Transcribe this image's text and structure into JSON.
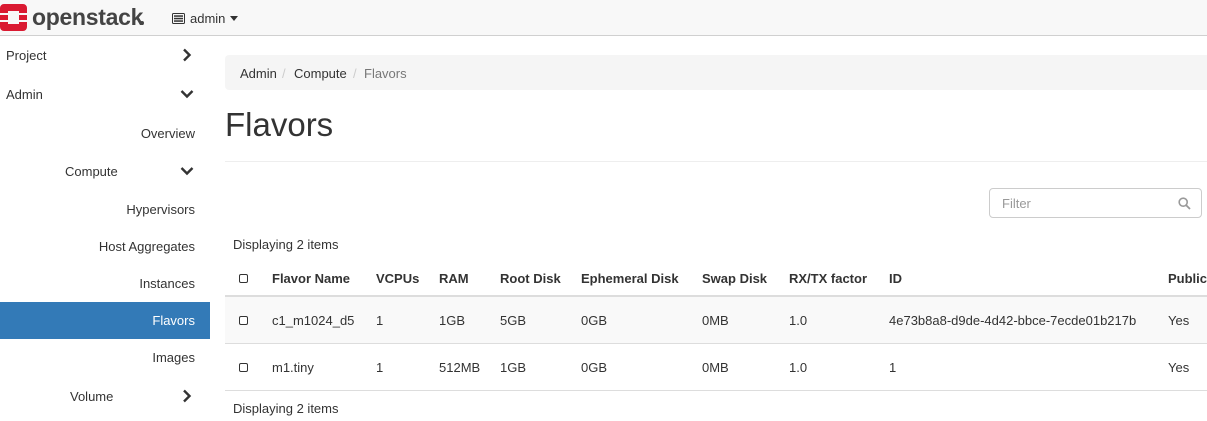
{
  "navbar": {
    "brand": "openstack",
    "project_menu": {
      "label": "admin"
    }
  },
  "sidebar": {
    "items": [
      {
        "label": "Project"
      },
      {
        "label": "Admin"
      },
      {
        "label": "Overview"
      },
      {
        "label": "Compute"
      },
      {
        "label": "Hypervisors"
      },
      {
        "label": "Host Aggregates"
      },
      {
        "label": "Instances"
      },
      {
        "label": "Flavors"
      },
      {
        "label": "Images"
      },
      {
        "label": "Volume"
      }
    ]
  },
  "breadcrumb": [
    "Admin",
    "Compute",
    "Flavors"
  ],
  "breadcrumb_separator": "/",
  "page": {
    "title": "Flavors",
    "filter_placeholder": "Filter",
    "item_count_top": "Displaying 2 items",
    "item_count_bottom": "Displaying 2 items"
  },
  "table": {
    "columns": [
      "Flavor Name",
      "VCPUs",
      "RAM",
      "Root Disk",
      "Ephemeral Disk",
      "Swap Disk",
      "RX/TX factor",
      "ID",
      "Public"
    ],
    "rows": [
      [
        "c1_m1024_d5",
        "1",
        "1GB",
        "5GB",
        "0GB",
        "0MB",
        "1.0",
        "4e73b8a8-d9de-4d42-bbce-7ecde01b217b",
        "Yes"
      ],
      [
        "m1.tiny",
        "1",
        "512MB",
        "1GB",
        "0GB",
        "0MB",
        "1.0",
        "1",
        "Yes"
      ]
    ]
  },
  "colors": {
    "brand_red": "#da1a32",
    "active_nav": "#337ab7",
    "navbar_bg": "#f8f8f8"
  },
  "icons": {
    "brand": "openstack-logo-icon",
    "project_menu": "server-list-icon",
    "expanded": "chevron-down-icon",
    "collapsed": "chevron-right-icon",
    "filter": "search-icon"
  }
}
